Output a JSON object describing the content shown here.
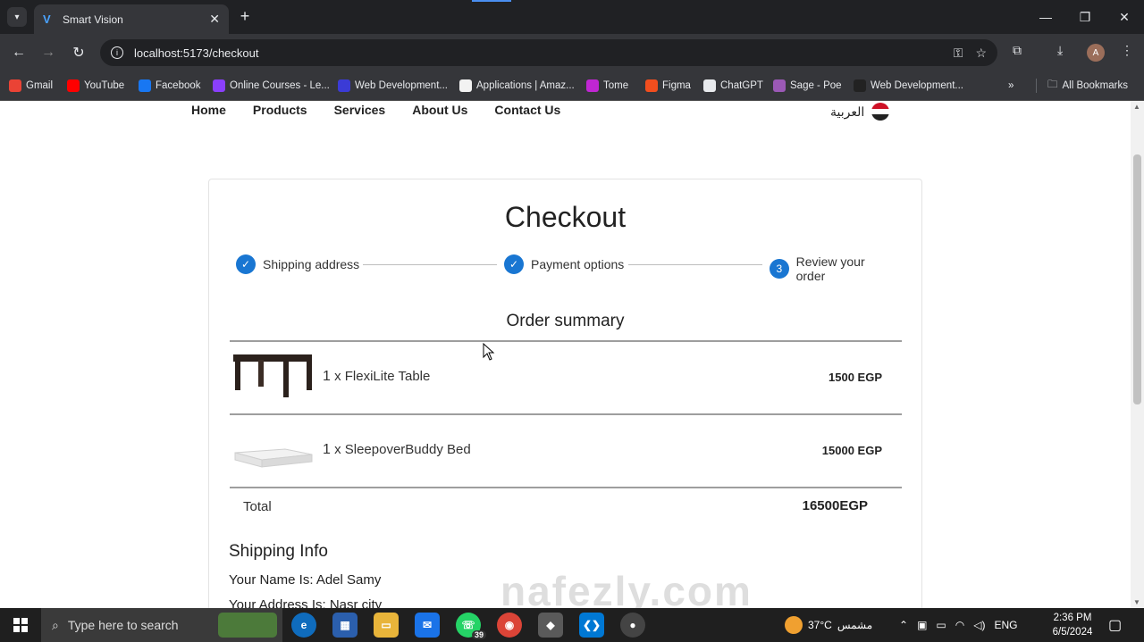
{
  "browser": {
    "tab_title": "Smart Vision",
    "url": "localhost:5173/checkout",
    "bookmarks": [
      {
        "label": "Gmail",
        "icon": "gmail-icon",
        "color": "#ea4335"
      },
      {
        "label": "YouTube",
        "icon": "youtube-icon",
        "color": "#ff0000"
      },
      {
        "label": "Facebook",
        "icon": "facebook-icon",
        "color": "#1877f2"
      },
      {
        "label": "Online Courses - Le...",
        "icon": "courses-icon",
        "color": "#8a3ffc"
      },
      {
        "label": "Web Development...",
        "icon": "webdev-icon",
        "color": "#3b3bd6"
      },
      {
        "label": "Applications | Amaz...",
        "icon": "amazon-icon",
        "color": "#f2f2f2"
      },
      {
        "label": "Tome",
        "icon": "tome-icon",
        "color": "#c026d3"
      },
      {
        "label": "Figma",
        "icon": "figma-icon",
        "color": "#f24e1e"
      },
      {
        "label": "ChatGPT",
        "icon": "chatgpt-icon",
        "color": "#e8eaed"
      },
      {
        "label": "Sage - Poe",
        "icon": "poe-icon",
        "color": "#9b59b6"
      },
      {
        "label": "Web Development...",
        "icon": "webdev-icon",
        "color": "#222222"
      }
    ],
    "all_bookmarks": "All Bookmarks",
    "avatar_letter": "A"
  },
  "site": {
    "nav": [
      "Home",
      "Products",
      "Services",
      "About Us",
      "Contact Us"
    ],
    "language": "العربية"
  },
  "checkout": {
    "title": "Checkout",
    "steps": [
      {
        "label": "Shipping address",
        "state": "completed",
        "marker": "✓"
      },
      {
        "label": "Payment options",
        "state": "completed",
        "marker": "✓"
      },
      {
        "label": "Review your order",
        "state": "active",
        "marker": "3"
      }
    ],
    "summary_title": "Order summary",
    "items": [
      {
        "qty": "1",
        "name": " x FlexiLite Table",
        "price": "1500 EGP"
      },
      {
        "qty": "1",
        "name": " x SleepoverBuddy Bed",
        "price": "15000 EGP"
      }
    ],
    "total_label": "Total",
    "total_value": "16500EGP",
    "shipping_title": "Shipping Info",
    "shipping_lines": [
      "Your Name Is: Adel Samy",
      "Your Address Is: Nasr city"
    ]
  },
  "watermark": "nafezly.com",
  "taskbar": {
    "search_placeholder": "Type here to search",
    "whatsapp_badge": "39",
    "weather": "37°C",
    "weather_text": "مشمس",
    "lang": "ENG",
    "time": "2:36 PM",
    "date": "6/5/2024"
  }
}
